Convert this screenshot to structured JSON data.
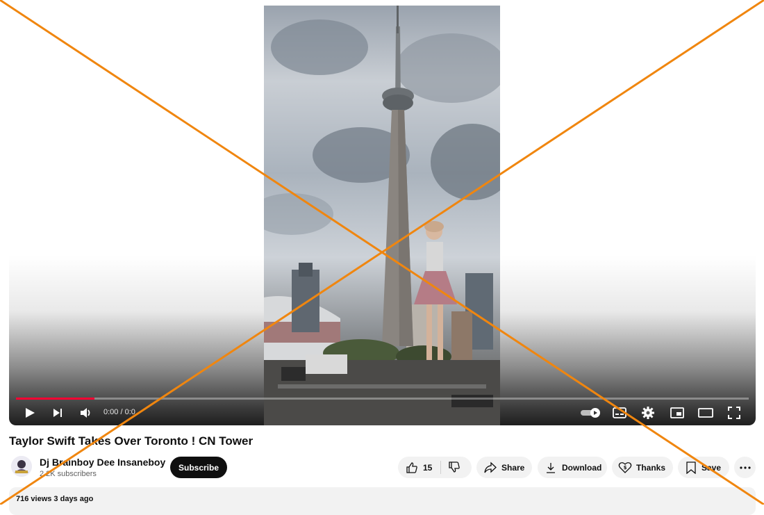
{
  "player": {
    "time": "0:00 / 0:0",
    "progress": 0.107,
    "icons": [
      "play-icon",
      "next-icon",
      "volume-icon",
      "autoplay-toggle",
      "subtitles-icon",
      "settings-icon",
      "miniplayer-icon",
      "theater-icon",
      "fullscreen-icon"
    ]
  },
  "video": {
    "title": "Taylor Swift Takes Over Toronto ! CN Tower",
    "views_date": "716 views  3 days ago"
  },
  "channel": {
    "name": "Dj Brainboy  Dee Insaneboy",
    "subscribers": "2.2K subscribers",
    "subscribe_label": "Subscribe"
  },
  "actions": {
    "like_count": "15",
    "share_label": "Share",
    "download_label": "Download",
    "thanks_label": "Thanks",
    "save_label": "Save"
  },
  "colors": {
    "progress": "#ff0033",
    "overlay_cross": "#f0860f",
    "button_bg": "#f2f2f2",
    "subscribe_bg": "#0f0f0f"
  }
}
